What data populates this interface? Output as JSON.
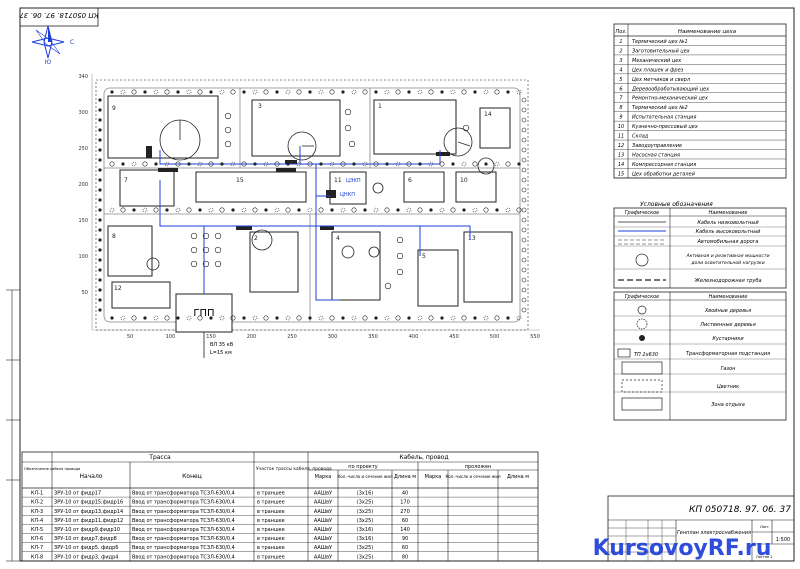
{
  "doc_code_rotated": "КП 050718. 97. 06. 37",
  "compass": {
    "north": "С",
    "south": "Ю"
  },
  "site_labels": {
    "gpp": "ГПП",
    "feed_line": "ВЛ 35 кВ",
    "feed_len": "L=15 км",
    "tp_main": "ЦЭКП",
    "tp_main_sub": "ЦНКП"
  },
  "x_ticks": [
    "50",
    "100",
    "150",
    "200",
    "250",
    "300",
    "350",
    "400",
    "450",
    "500",
    "550"
  ],
  "y_ticks": [
    "340",
    "300",
    "250",
    "200",
    "150",
    "100",
    "50"
  ],
  "workshop_list": {
    "col_no": "Поз.",
    "col_name": "Наименование цеха",
    "rows": [
      {
        "no": "1",
        "name": "Термический цех №1"
      },
      {
        "no": "2",
        "name": "Заготовительный цех"
      },
      {
        "no": "3",
        "name": "Механический цех"
      },
      {
        "no": "4",
        "name": "Цех плашек и фрез"
      },
      {
        "no": "5",
        "name": "Цех метчиков и сверл"
      },
      {
        "no": "6",
        "name": "Деревообрабатывающий цех"
      },
      {
        "no": "7",
        "name": "Ремонтно-механический цех"
      },
      {
        "no": "8",
        "name": "Термический цех №2"
      },
      {
        "no": "9",
        "name": "Испытательная станция"
      },
      {
        "no": "10",
        "name": "Кузнечно-прессовый цех"
      },
      {
        "no": "11",
        "name": "Склад"
      },
      {
        "no": "12",
        "name": "Заводоуправление"
      },
      {
        "no": "13",
        "name": "Насосная станция"
      },
      {
        "no": "14",
        "name": "Компрессорная станция"
      },
      {
        "no": "15",
        "name": "Цех обработки деталей"
      }
    ]
  },
  "legend1": {
    "title": "Условные обозначения",
    "col_sym": "Графическое",
    "col_name": "Наименование",
    "rows": [
      "Кабель низковольтный",
      "Кабель высоковольтный",
      "Автомобильная дорога",
      "Активная и реактивная мощности доли осветительной нагрузки",
      "Железнодорожная труба"
    ]
  },
  "legend2": {
    "col_sym": "Графическое",
    "col_name": "Наименование",
    "tp_sym": "ТП 2х630",
    "rows": [
      "Хвойные деревья",
      "Лиственные деревья",
      "Кустарники",
      "Трансформаторная подстанция",
      "Газон",
      "Цветник",
      "Зона отдыха"
    ]
  },
  "cable_table": {
    "title_route": "Трасса",
    "title_cable": "Кабель, провод",
    "col_id": "Обозначение кабеля провода",
    "col_start": "Начало",
    "col_end": "Конец",
    "col_section": "Участок трассы кабеля, провода",
    "sub_project": "по проекту",
    "sub_laid": "проложен",
    "col_mark": "Марка",
    "col_cores": "Кол.-число и сечение жил",
    "col_len": "Длина м",
    "rows": [
      {
        "id": "КЛ-1",
        "start": "ЗРУ-10 от фидр17",
        "end": "Ввод от трансформатора ТСЗЛ-630/0,4",
        "section": "в траншее",
        "mark": "ААШвУ",
        "cores": "(3х16)",
        "len": "40"
      },
      {
        "id": "КЛ-2",
        "start": "ЗРУ-10 от фидр15,фидр16",
        "end": "Ввод от трансформатора ТСЗЛ-630/0,4",
        "section": "в траншее",
        "mark": "ААШвУ",
        "cores": "(3х25)",
        "len": "170"
      },
      {
        "id": "КЛ-3",
        "start": "ЗРУ-10 от фидр13,фидр14",
        "end": "Ввод от трансформатора ТСЗЛ-630/0,4",
        "section": "в траншее",
        "mark": "ААШвУ",
        "cores": "(3х25)",
        "len": "270"
      },
      {
        "id": "КЛ-4",
        "start": "ЗРУ-10 от фидр11,фидр12",
        "end": "Ввод от трансформатора ТСЗЛ-630/0,4",
        "section": "в траншее",
        "mark": "ААШвУ",
        "cores": "(3х25)",
        "len": "60"
      },
      {
        "id": "КЛ-5",
        "start": "ЗРУ-10 от фидр9,фидр10",
        "end": "Ввод от трансформатора ТСЗЛ-630/0,4",
        "section": "в траншее",
        "mark": "ААШвУ",
        "cores": "(3х16)",
        "len": "140"
      },
      {
        "id": "КЛ-6",
        "start": "ЗРУ-10 от фидр7,фидр8",
        "end": "Ввод от трансформатора ТСЗЛ-630/0,4",
        "section": "в траншее",
        "mark": "ААШвУ",
        "cores": "(3х16)",
        "len": "90"
      },
      {
        "id": "КЛ-7",
        "start": "ЗРУ-10 от фидр5, фидр6",
        "end": "Ввод от трансформатора ТСЗЛ-630/0,4",
        "section": "в траншее",
        "mark": "ААШвУ",
        "cores": "(3х25)",
        "len": "60"
      },
      {
        "id": "КЛ-8",
        "start": "ЗРУ-10 от фидр3, фидр4",
        "end": "Ввод от трансформатора ТСЗЛ-630/0,4",
        "section": "в траншее",
        "mark": "ААШвУ",
        "cores": "(3х25)",
        "len": "80"
      }
    ]
  },
  "title_block": {
    "doc_code": "КП 050718. 97. 06. 37",
    "sheet_name": "Генплан электроснабжения",
    "scale": "1:500",
    "watermark": "KursovoyRF.ru",
    "sheet_label": "Лист",
    "sheets_label": "Листов 1"
  },
  "colors": {
    "ink": "#1a1a1a",
    "wire_hv": "#1d3fd8",
    "label_blue": "#1d3fd8",
    "fill_dark": "#222222"
  }
}
